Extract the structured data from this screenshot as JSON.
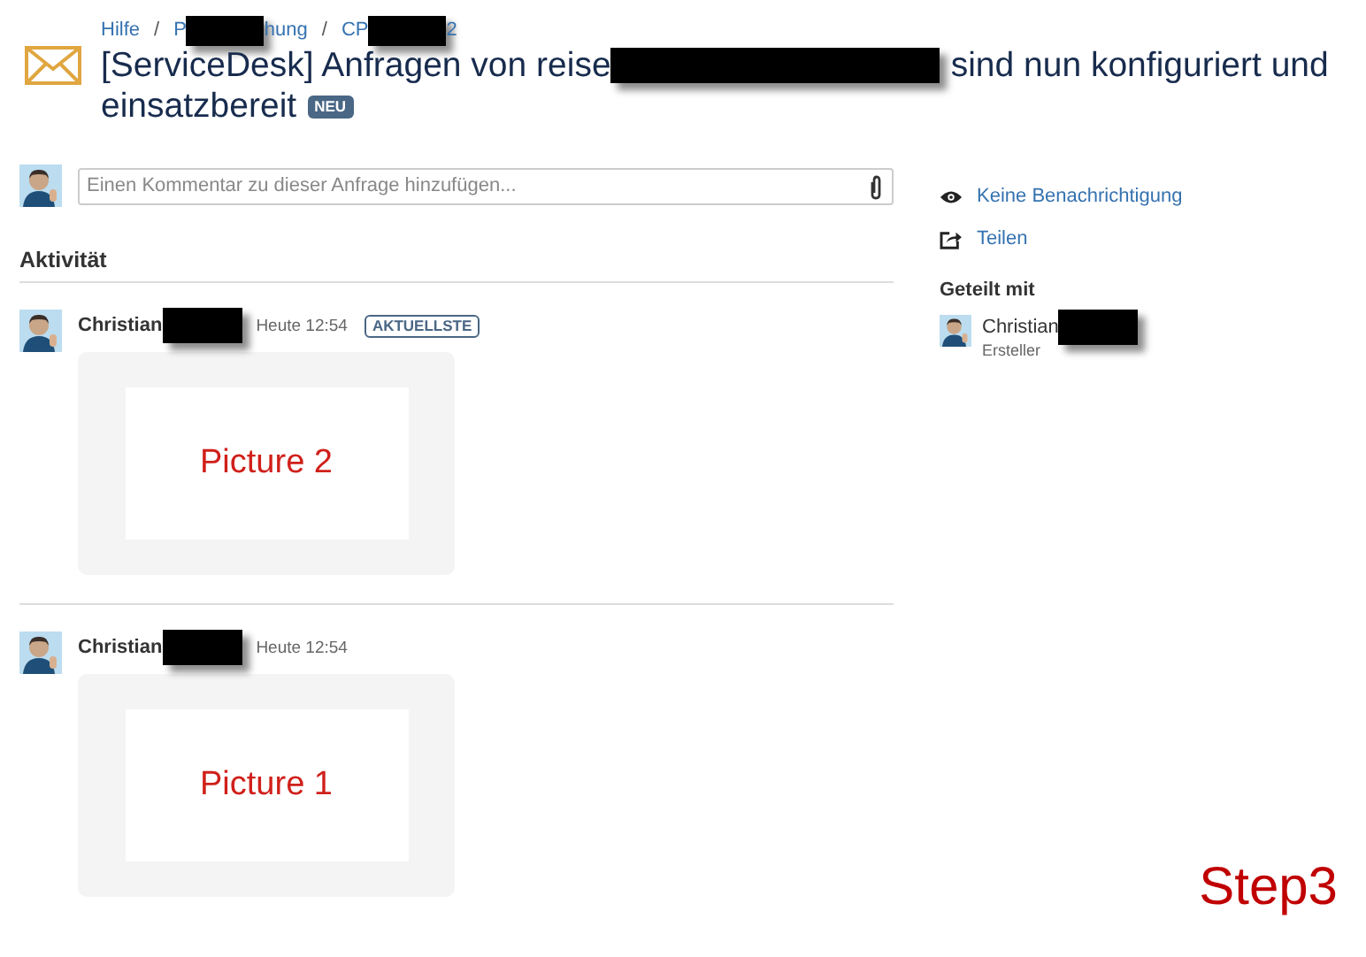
{
  "breadcrumbs": [
    {
      "before": "Hilfe",
      "redacted": false
    },
    {
      "separator": "/",
      "before": "P",
      "redacted": true,
      "after": "hung"
    },
    {
      "separator": "/",
      "before": "CP",
      "redacted": true,
      "after": "2"
    }
  ],
  "title": {
    "before": "[ServiceDesk] Anfragen von reise",
    "redacted": true,
    "after": "sind nun konfiguriert und",
    "continuation": "einsatzbereit",
    "badge": "NEU"
  },
  "comment_field": {
    "placeholder": "Einen Kommentar zu dieser Anfrage hinzufügen..."
  },
  "activity": {
    "heading": "Aktivität",
    "items": [
      {
        "author": "Christian",
        "redacted": true,
        "time": "Heute 12:54",
        "tag": "AKTUELLSTE",
        "attachment": "Picture 2"
      },
      {
        "author": "Christian",
        "redacted": true,
        "time": "Heute 12:54",
        "attachment": "Picture 1"
      }
    ]
  },
  "sidebar": {
    "actions": [
      {
        "kind": "watch",
        "label": "Keine Benachrichtigung"
      },
      {
        "kind": "share",
        "label": "Teilen"
      }
    ],
    "shared_heading": "Geteilt mit",
    "participants": [
      {
        "name": "Christian",
        "redacted": true,
        "role": "Ersteller"
      }
    ]
  },
  "annotation": "Step3"
}
